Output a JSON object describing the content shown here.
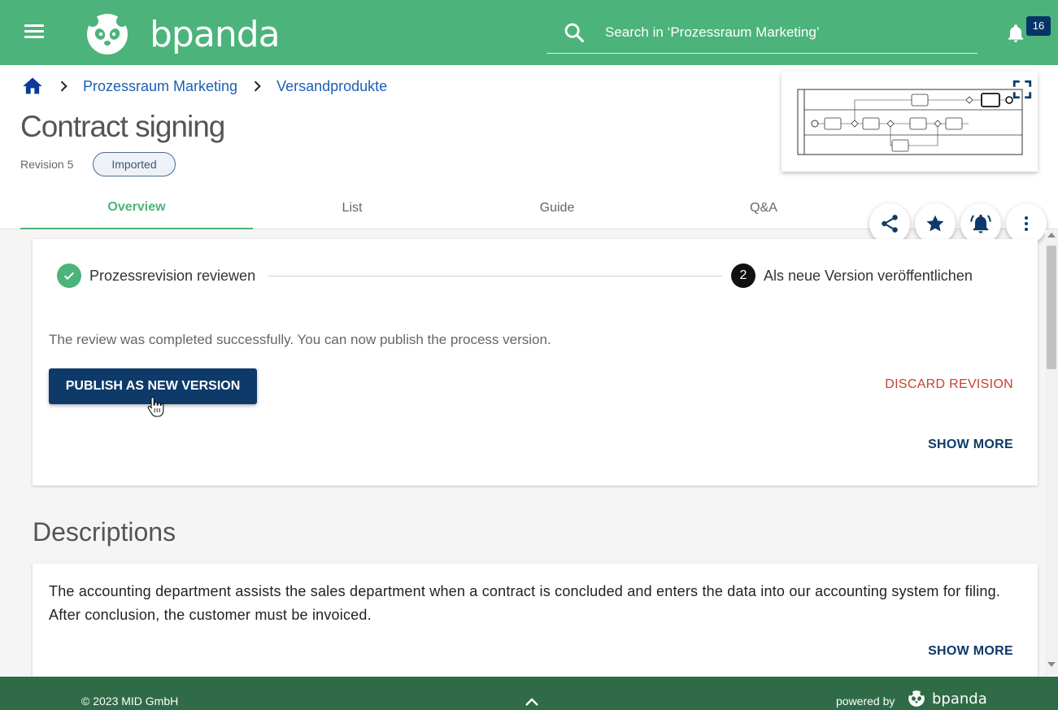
{
  "header": {
    "brand": "bpanda",
    "search_placeholder": "Search in ‘Prozessraum Marketing’",
    "notification_count": "16",
    "colors": {
      "primary": "#4cb37a",
      "badge": "#053468"
    }
  },
  "breadcrumb": {
    "items": [
      "Prozessraum Marketing",
      "Versandprodukte"
    ]
  },
  "page": {
    "title": "Contract signing",
    "revision": "Revision 5",
    "status_chip": "Imported"
  },
  "tabs": [
    {
      "label": "Overview",
      "active": true
    },
    {
      "label": "List",
      "active": false
    },
    {
      "label": "Guide",
      "active": false
    },
    {
      "label": "Q&A",
      "active": false
    }
  ],
  "actions": {
    "icons": [
      "share-icon",
      "star-icon",
      "bell-ring-icon",
      "more-vertical-icon"
    ]
  },
  "review": {
    "step1_label": "Prozessrevision reviewen",
    "step2_number": "2",
    "step2_label": "Als neue Version veröffentlichen",
    "message": "The review was completed successfully. You can now publish the process version.",
    "publish_label": "PUBLISH AS NEW VERSION",
    "discard_label": "DISCARD REVISION",
    "show_more_label": "SHOW MORE"
  },
  "descriptions": {
    "title": "Descriptions",
    "text": "The accounting department assists the sales department when a contract is concluded and enters the data into our accounting system for filing. After conclusion, the customer must be invoiced.",
    "show_more_label": "SHOW MORE"
  },
  "footer": {
    "copyright": "© 2023 MID GmbH",
    "powered_by": "powered by",
    "brand": "bpanda"
  }
}
